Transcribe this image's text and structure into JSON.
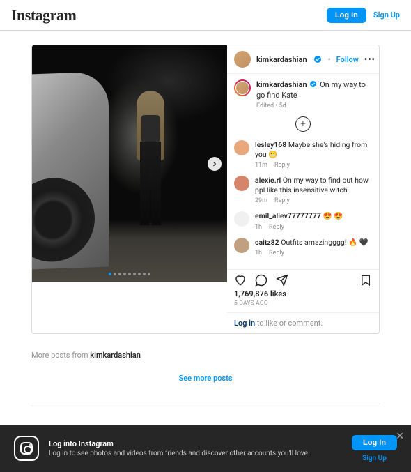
{
  "header": {
    "logo": "Instagram",
    "login": "Log In",
    "signup": "Sign Up"
  },
  "post": {
    "author": "kimkardashian",
    "follow": "Follow",
    "caption": "On my way to go find Kate",
    "edited": "Edited",
    "caption_time": "5d",
    "likes": "1,769,876 likes",
    "time_ago": "5 days ago",
    "login_cta_link": "Log in",
    "login_cta_rest": " to like or comment.",
    "reply_label": "Reply"
  },
  "comments": [
    {
      "user": "lesley168",
      "text": "Maybe she's hiding from you 😬",
      "time": "11m"
    },
    {
      "user": "alexie.rl",
      "text": "On my way to find out how ppl like this insensitive witch",
      "time": "29m"
    },
    {
      "user": "emil_aliev77777777",
      "text": "😍 😍",
      "time": "1h"
    },
    {
      "user": "caitz82",
      "text": "Outfits amazingggg! 🔥 🖤",
      "time": "1h"
    }
  ],
  "more_posts": {
    "prefix": "More posts from ",
    "author": "kimkardashian",
    "see_more": "See more posts"
  },
  "banner": {
    "title": "Log into Instagram",
    "subtitle": "Log in to see photos and videos from friends and discover other accounts you'll love.",
    "login": "Log In",
    "signup": "Sign Up"
  }
}
